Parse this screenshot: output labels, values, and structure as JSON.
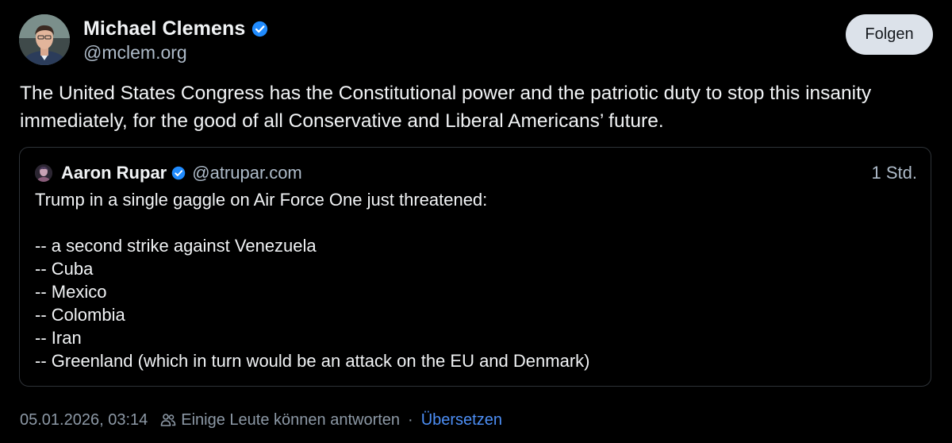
{
  "author": {
    "name": "Michael Clemens",
    "handle": "@mclem.org",
    "verified": true
  },
  "follow_button": {
    "label": "Folgen"
  },
  "post": {
    "text": "The United States Congress has the Constitutional power and the patriotic duty to stop this insanity immediately, for the good of all Conservative and Liberal Americans’ future."
  },
  "quote": {
    "author_name": "Aaron Rupar",
    "author_handle": "@atrupar.com",
    "verified": true,
    "time": "1 Std.",
    "lines": [
      "Trump in a single gaggle on Air Force One just threatened:",
      "",
      "-- a second strike against Venezuela",
      "-- Cuba",
      "-- Mexico",
      "-- Colombia",
      "-- Iran",
      "-- Greenland (which in turn would be an attack on the EU and Denmark)"
    ]
  },
  "footer": {
    "timestamp": "05.01.2026, 03:14",
    "reply_setting": "Einige Leute können antworten",
    "separator": "·",
    "translate_label": "Übersetzen"
  },
  "colors": {
    "background": "#000000",
    "accent": "#4d8ff6",
    "verified": "#208bfe",
    "muted_text": "#aebbc9",
    "border": "#2e3338",
    "follow_button_bg": "#dce2ea"
  },
  "icons": {
    "verified": "verified-badge-icon",
    "reply_setting": "people-icon"
  }
}
